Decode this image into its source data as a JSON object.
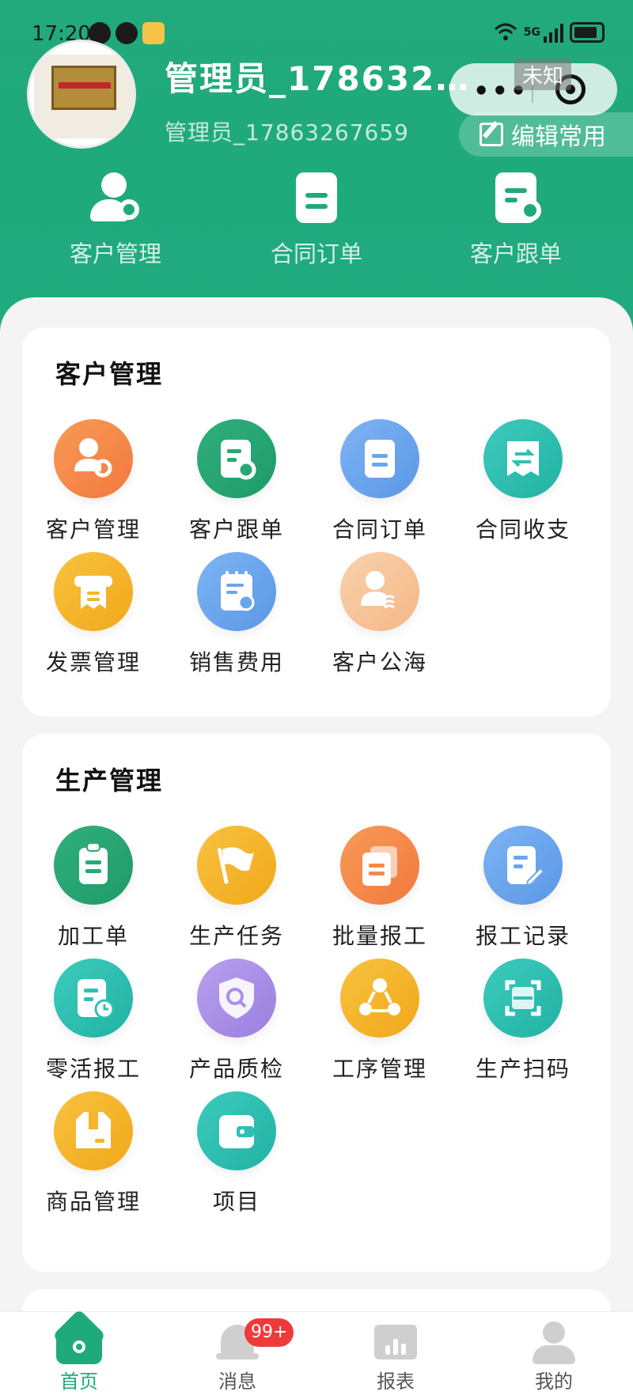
{
  "status_bar": {
    "time": "17:20",
    "network": "5G"
  },
  "header": {
    "username": "管理员_1786326…",
    "user_sub": "管理员_17863267659",
    "unknown_tag": "未知",
    "more": "•••",
    "edit_label": "编辑常用"
  },
  "quick_actions": [
    {
      "label": "客户管理",
      "icon": "customer-gear-icon"
    },
    {
      "label": "合同订单",
      "icon": "document-icon"
    },
    {
      "label": "客户跟单",
      "icon": "document-gear-icon"
    }
  ],
  "customer_section": {
    "title": "客户管理",
    "items": [
      {
        "label": "客户管理",
        "icon": "customer-gear-icon",
        "color": "#f5894a"
      },
      {
        "label": "客户跟单",
        "icon": "document-gear-icon",
        "color": "#26a974"
      },
      {
        "label": "合同订单",
        "icon": "document-icon",
        "color": "#6aa6ee"
      },
      {
        "label": "合同收支",
        "icon": "exchange-receipt-icon",
        "color": "#2fc0b3"
      },
      {
        "label": "发票管理",
        "icon": "invoice-printer-icon",
        "color": "#f6b52b"
      },
      {
        "label": "销售费用",
        "icon": "expense-note-icon",
        "color": "#69a6ec"
      },
      {
        "label": "客户公海",
        "icon": "customer-pool-icon",
        "color": "#f6c49b"
      }
    ]
  },
  "production_section": {
    "title": "生产管理",
    "items": [
      {
        "label": "加工单",
        "icon": "clipboard-icon",
        "color": "#26a974"
      },
      {
        "label": "生产任务",
        "icon": "flag-icon",
        "color": "#f6b52b"
      },
      {
        "label": "批量报工",
        "icon": "stacked-documents-icon",
        "color": "#f5894a"
      },
      {
        "label": "报工记录",
        "icon": "document-edit-icon",
        "color": "#6aa6ee"
      },
      {
        "label": "零活报工",
        "icon": "document-clock-icon",
        "color": "#2fc0b3"
      },
      {
        "label": "产品质检",
        "icon": "shield-search-icon",
        "color": "#ab8fe6"
      },
      {
        "label": "工序管理",
        "icon": "process-nodes-icon",
        "color": "#f6b52b"
      },
      {
        "label": "生产扫码",
        "icon": "scan-frame-icon",
        "color": "#2fc0b3"
      },
      {
        "label": "商品管理",
        "icon": "package-box-icon",
        "color": "#f6b52b"
      },
      {
        "label": "项目",
        "icon": "wallet-icon",
        "color": "#2fc0b3"
      }
    ]
  },
  "tabbar": [
    {
      "label": "首页",
      "active": true
    },
    {
      "label": "消息",
      "badge": "99+"
    },
    {
      "label": "报表"
    },
    {
      "label": "我的"
    }
  ],
  "colors": {
    "brand_green": "#1faa7c",
    "badge_red": "#ef3a3a"
  }
}
